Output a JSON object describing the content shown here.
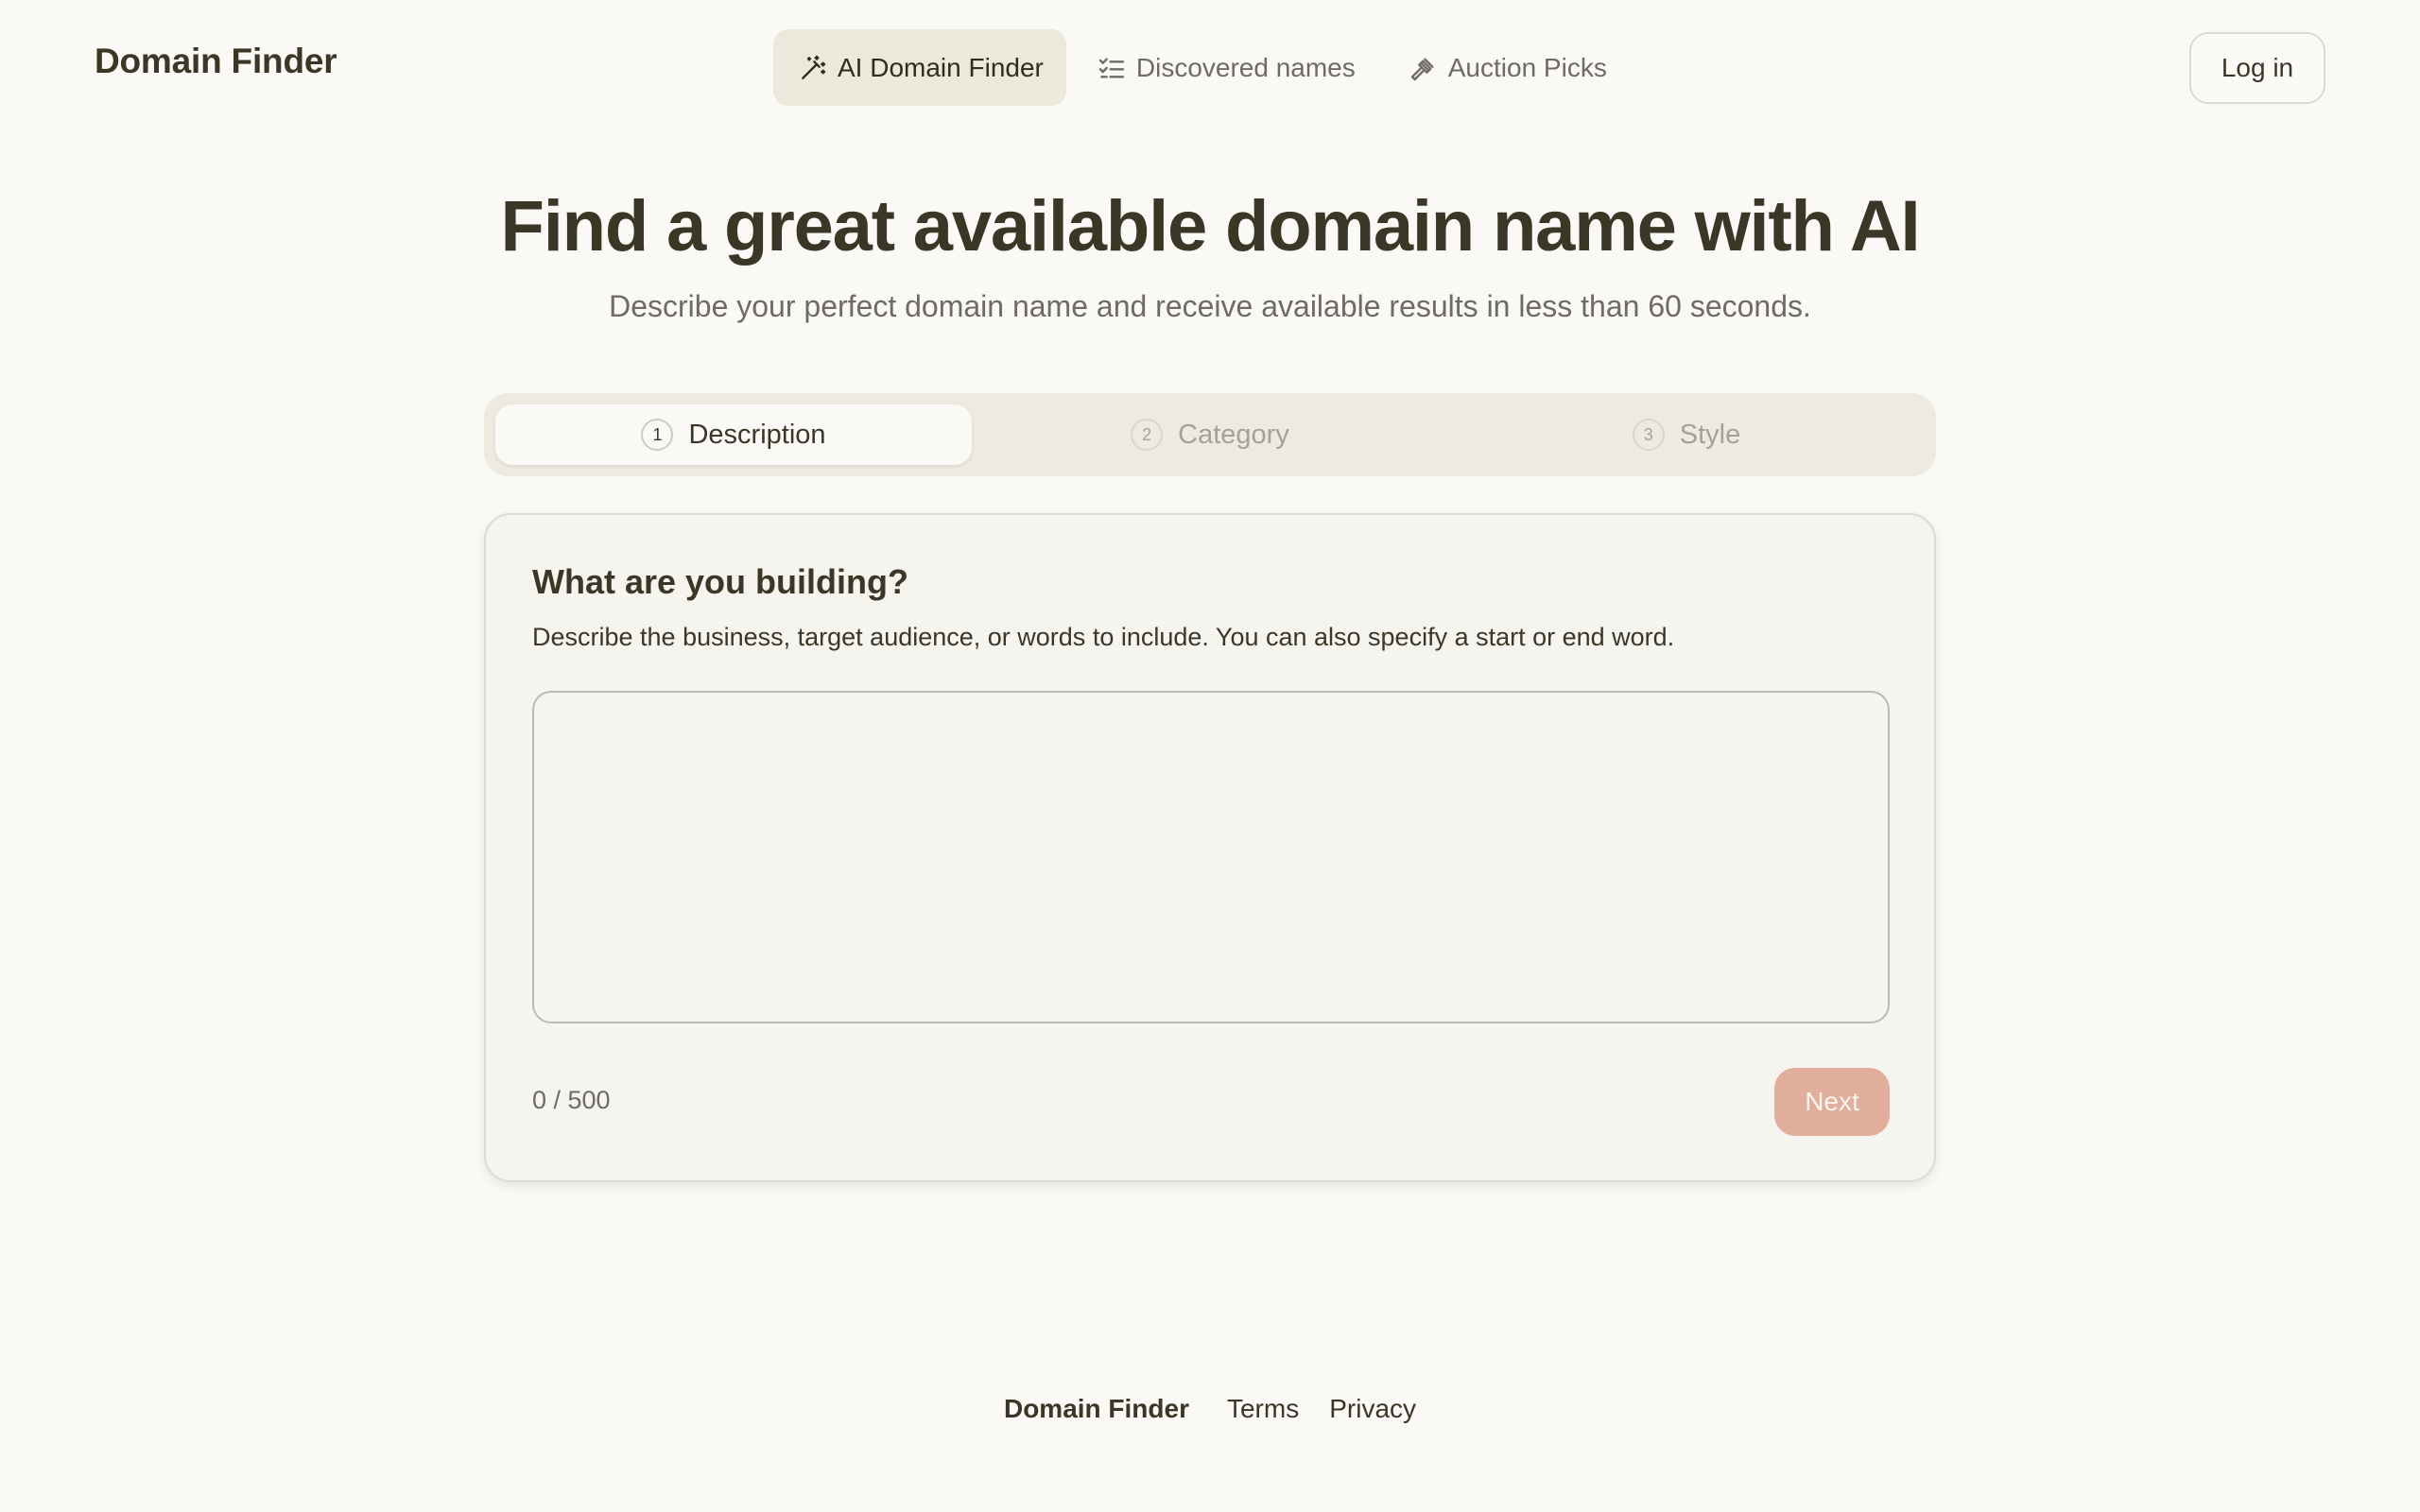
{
  "header": {
    "brand": "Domain Finder",
    "nav": [
      {
        "label": "AI Domain Finder",
        "icon": "magic-wand-icon",
        "active": true
      },
      {
        "label": "Discovered names",
        "icon": "checklist-icon",
        "active": false
      },
      {
        "label": "Auction Picks",
        "icon": "gavel-icon",
        "active": false
      }
    ],
    "login_label": "Log in"
  },
  "hero": {
    "title": "Find a great available domain name with AI",
    "subtitle": "Describe your perfect domain name and receive available results in less than 60 seconds."
  },
  "stepper": {
    "steps": [
      {
        "number": "1",
        "label": "Description",
        "active": true
      },
      {
        "number": "2",
        "label": "Category",
        "active": false
      },
      {
        "number": "3",
        "label": "Style",
        "active": false
      }
    ]
  },
  "form": {
    "title": "What are you building?",
    "description": "Describe the business, target audience, or words to include. You can also specify a start or end word.",
    "textarea_value": "",
    "char_count": "0 / 500",
    "next_label": "Next"
  },
  "footer": {
    "brand": "Domain Finder",
    "links": [
      "Terms",
      "Privacy"
    ]
  },
  "colors": {
    "background": "#faf9f5",
    "text": "#3a3726",
    "muted": "#6e6b62",
    "accent_button": "#e0ae9a",
    "active_nav_bg": "#ebe8dc"
  }
}
